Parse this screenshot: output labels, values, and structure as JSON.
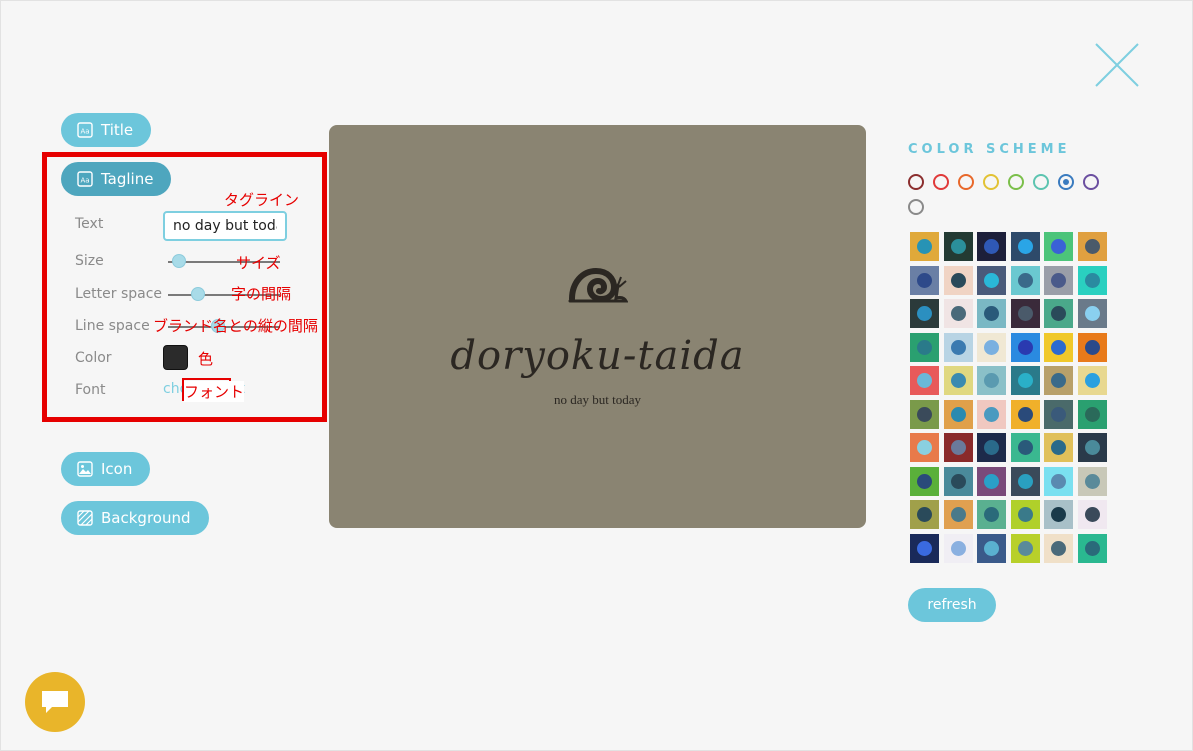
{
  "sidebar": {
    "title_label": "Title",
    "tagline_label": "Tagline",
    "icon_label": "Icon",
    "background_label": "Background",
    "fields": {
      "text_label": "Text",
      "text_value": "no day but today",
      "size_label": "Size",
      "size_value": 0.1,
      "letter_space_label": "Letter space",
      "letter_space_value": 0.27,
      "line_space_label": "Line space",
      "line_space_value": 0.45,
      "color_label": "Color",
      "color_value": "#2b2b2b",
      "font_label": "Font",
      "font_link": "choose font"
    }
  },
  "annotations": {
    "tagline": "タグライン",
    "size": "サイズ",
    "letter_space": "字の間隔",
    "line_space": "ブランド名との縦の間隔",
    "color": "色",
    "font": "フォント"
  },
  "preview": {
    "brand_name": "doryoku-taida",
    "tagline": "no day but today",
    "background": "#8a8472",
    "icon": "snail-icon"
  },
  "color_scheme": {
    "title": "COLOR SCHEME",
    "refresh_label": "refresh",
    "filters": [
      "#8b2e2e",
      "#e03a3a",
      "#e8682a",
      "#e2c234",
      "#7bbf4a",
      "#5cc4b0",
      "#3a7bbf",
      "#6b4fa0",
      "#8a8a8a"
    ],
    "selected_filter": 6,
    "swatches": [
      [
        "#e0a93a",
        "#2793b5"
      ],
      [
        "#233a33",
        "#2b8f9b"
      ],
      [
        "#1d1f3a",
        "#2f58b5"
      ],
      [
        "#2e4a6a",
        "#2aa5e6"
      ],
      [
        "#4cc47a",
        "#3a62d6"
      ],
      [
        "#e0a040",
        "#4a5a6a"
      ],
      [
        "#6a7fa5",
        "#2e4a8a"
      ],
      [
        "#f0d4c4",
        "#2a4a5a"
      ],
      [
        "#4a5a7a",
        "#2ab8d8"
      ],
      [
        "#6ac8d0",
        "#3a6a8a"
      ],
      [
        "#9a9ea8",
        "#4a5a8a"
      ],
      [
        "#2ad0c0",
        "#2a8aa0"
      ],
      [
        "#2b3a3a",
        "#2b8fc0"
      ],
      [
        "#f0e4e4",
        "#4a6a7a"
      ],
      [
        "#7ab8c4",
        "#2a5a7a"
      ],
      [
        "#3a2a3a",
        "#4a5a6a"
      ],
      [
        "#4aa88a",
        "#2a4a5a"
      ],
      [
        "#6a7a8a",
        "#8ad0f0"
      ],
      [
        "#2aa070",
        "#2a7a8a"
      ],
      [
        "#b8d4e4",
        "#3a7ab0"
      ],
      [
        "#f0e8d4",
        "#7ab0e0"
      ],
      [
        "#2a8ae0",
        "#2a3ab0"
      ],
      [
        "#f0c82a",
        "#2a6ad0"
      ],
      [
        "#e87a1a",
        "#2a4a8a"
      ],
      [
        "#e85a5a",
        "#6ab8d8"
      ],
      [
        "#e0d880",
        "#3a8ab0"
      ],
      [
        "#8ac0c8",
        "#5a9ab0"
      ],
      [
        "#2a7a8a",
        "#2ab0c8"
      ],
      [
        "#b8a06a",
        "#3a6a8a"
      ],
      [
        "#e8d890",
        "#2aa0e0"
      ],
      [
        "#7a9a4a",
        "#3a4a5a"
      ],
      [
        "#e0a04a",
        "#2a8ab0"
      ],
      [
        "#f0c8c0",
        "#4a9ac0"
      ],
      [
        "#f0b02a",
        "#2a4a7a"
      ],
      [
        "#4a6a6a",
        "#3a5a7a"
      ],
      [
        "#2aa070",
        "#2a6a5a"
      ],
      [
        "#e87a4a",
        "#8ad0e0"
      ],
      [
        "#8a2a2a",
        "#6a7a9a"
      ],
      [
        "#1d2a4a",
        "#2a6a8a"
      ],
      [
        "#3ab890",
        "#2a5a7a"
      ],
      [
        "#e0c05a",
        "#2a6a8a"
      ],
      [
        "#2a3a4a",
        "#4a8a9a"
      ],
      [
        "#5ab03a",
        "#2a4a7a"
      ],
      [
        "#4a8a9a",
        "#2a4a5a"
      ],
      [
        "#7a4a7a",
        "#2aa0c8"
      ],
      [
        "#3a4a5a",
        "#2aa0c0"
      ],
      [
        "#7ae0f0",
        "#5a8ab0"
      ],
      [
        "#c8c8b8",
        "#5a8a9a"
      ],
      [
        "#a0a04a",
        "#2a4a5a"
      ],
      [
        "#e0a050",
        "#4a7a8a"
      ],
      [
        "#5ab090",
        "#2a6a7a"
      ],
      [
        "#b0d02a",
        "#3a7a8a"
      ],
      [
        "#a8c0c8",
        "#1a3a4a"
      ],
      [
        "#f0e8f0",
        "#3a4a5a"
      ],
      [
        "#1a2a5a",
        "#3a6ae0"
      ],
      [
        "#f0eef4",
        "#8ab0e0"
      ],
      [
        "#3a5a8a",
        "#5ab0d0"
      ],
      [
        "#b8d02a",
        "#5a8a9a"
      ],
      [
        "#f0e0c8",
        "#4a6a7a"
      ],
      [
        "#2ab890",
        "#2a6a7a"
      ]
    ]
  }
}
